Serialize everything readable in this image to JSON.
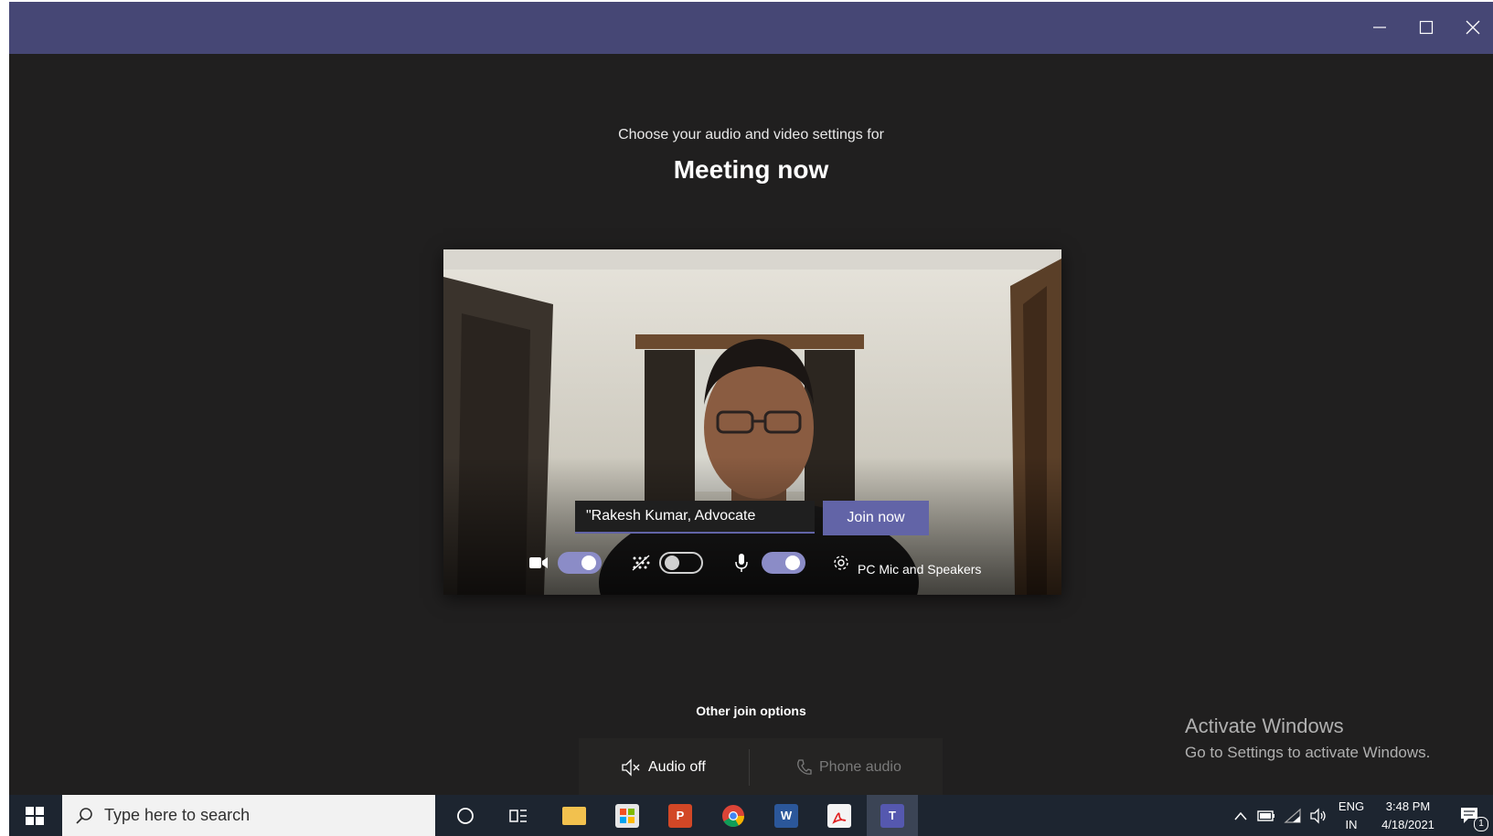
{
  "window": {
    "minimize_label": "Minimize",
    "maximize_label": "Maximize",
    "close_label": "Close"
  },
  "header": {
    "subtitle": "Choose your audio and video settings for",
    "title": "Meeting now"
  },
  "prejoin": {
    "name_value": "\"Rakesh Kumar, Advocate",
    "join_label": "Join now",
    "camera_on": true,
    "background_blur_on": false,
    "mic_on": true,
    "device_label": "PC Mic and Speakers"
  },
  "other_options": {
    "heading": "Other join options",
    "audio_off_label": "Audio off",
    "phone_audio_label": "Phone audio"
  },
  "watermark": {
    "line1": "Activate Windows",
    "line2": "Go to Settings to activate Windows."
  },
  "taskbar": {
    "search_placeholder": "Type here to search",
    "apps": [
      "cortana-icon",
      "task-view-icon",
      "file-explorer-icon",
      "store-icon",
      "powerpoint-icon",
      "chrome-icon",
      "word-icon",
      "acrobat-icon",
      "teams-icon"
    ],
    "language_top": "ENG",
    "language_bottom": "IN",
    "time": "3:48 PM",
    "date": "4/18/2021",
    "notification_count": "1"
  },
  "colors": {
    "titlebar": "#464775",
    "accent": "#6264a7",
    "background": "#201f1f",
    "taskbar": "#1d2530"
  }
}
